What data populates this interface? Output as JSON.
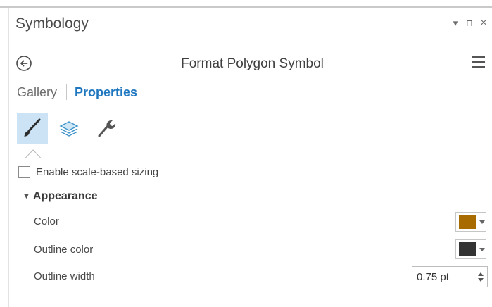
{
  "pane": {
    "title": "Symbology",
    "controls": {
      "dropdown_label": "▾",
      "pin_label": "⊓",
      "close_label": "×"
    }
  },
  "header": {
    "back_icon": "back-arrow-circle-icon",
    "title": "Format Polygon Symbol",
    "menu_icon": "hamburger-menu-icon"
  },
  "tabs": [
    {
      "label": "Gallery",
      "active": false
    },
    {
      "label": "Properties",
      "active": true
    }
  ],
  "icon_tabs": [
    {
      "icon": "paintbrush-icon",
      "active": true
    },
    {
      "icon": "layers-icon",
      "active": false
    },
    {
      "icon": "wrench-icon",
      "active": false
    }
  ],
  "scale_sizing": {
    "label": "Enable scale-based sizing",
    "checked": false
  },
  "appearance": {
    "label": "Appearance",
    "expanded": true,
    "color": {
      "label": "Color",
      "value": "#a86b00"
    },
    "outline_color": {
      "label": "Outline color",
      "value": "#333333"
    },
    "outline_width": {
      "label": "Outline width",
      "value": "0.75 pt"
    }
  },
  "colors": {
    "accent": "#1f77c0",
    "active_tab_bg": "#cbe3f4"
  }
}
